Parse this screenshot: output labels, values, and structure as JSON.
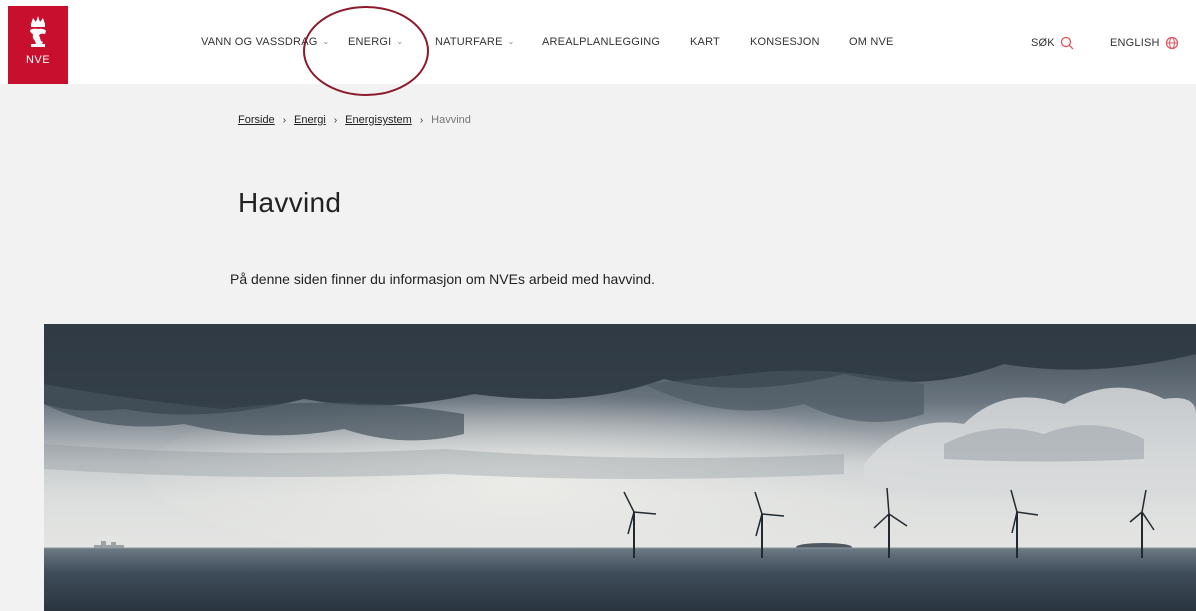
{
  "logo": {
    "text": "NVE"
  },
  "nav": {
    "items": [
      {
        "label": "VANN OG VASSDRAG",
        "has_dropdown": true
      },
      {
        "label": "ENERGI",
        "has_dropdown": true
      },
      {
        "label": "NATURFARE",
        "has_dropdown": true
      },
      {
        "label": "AREALPLANLEGGING",
        "has_dropdown": false
      },
      {
        "label": "KART",
        "has_dropdown": false
      },
      {
        "label": "KONSESJON",
        "has_dropdown": false
      },
      {
        "label": "OM NVE",
        "has_dropdown": false
      }
    ],
    "search_label": "SØK",
    "language_label": "ENGLISH"
  },
  "breadcrumb": {
    "links": [
      "Forside",
      "Energi",
      "Energisystem"
    ],
    "current": "Havvind"
  },
  "page": {
    "title": "Havvind",
    "lead": "På denne siden finner du informasjon om NVEs arbeid med havvind."
  },
  "colors": {
    "brand": "#c8102e",
    "annotation": "#8b1a2a",
    "accent_icon": "#e0525f"
  },
  "icons": [
    "crown-lion-logo-icon",
    "chevron-down-icon",
    "search-icon",
    "globe-icon"
  ],
  "hero": {
    "subject": "offshore-wind-turbines",
    "turbine_count": 5
  }
}
